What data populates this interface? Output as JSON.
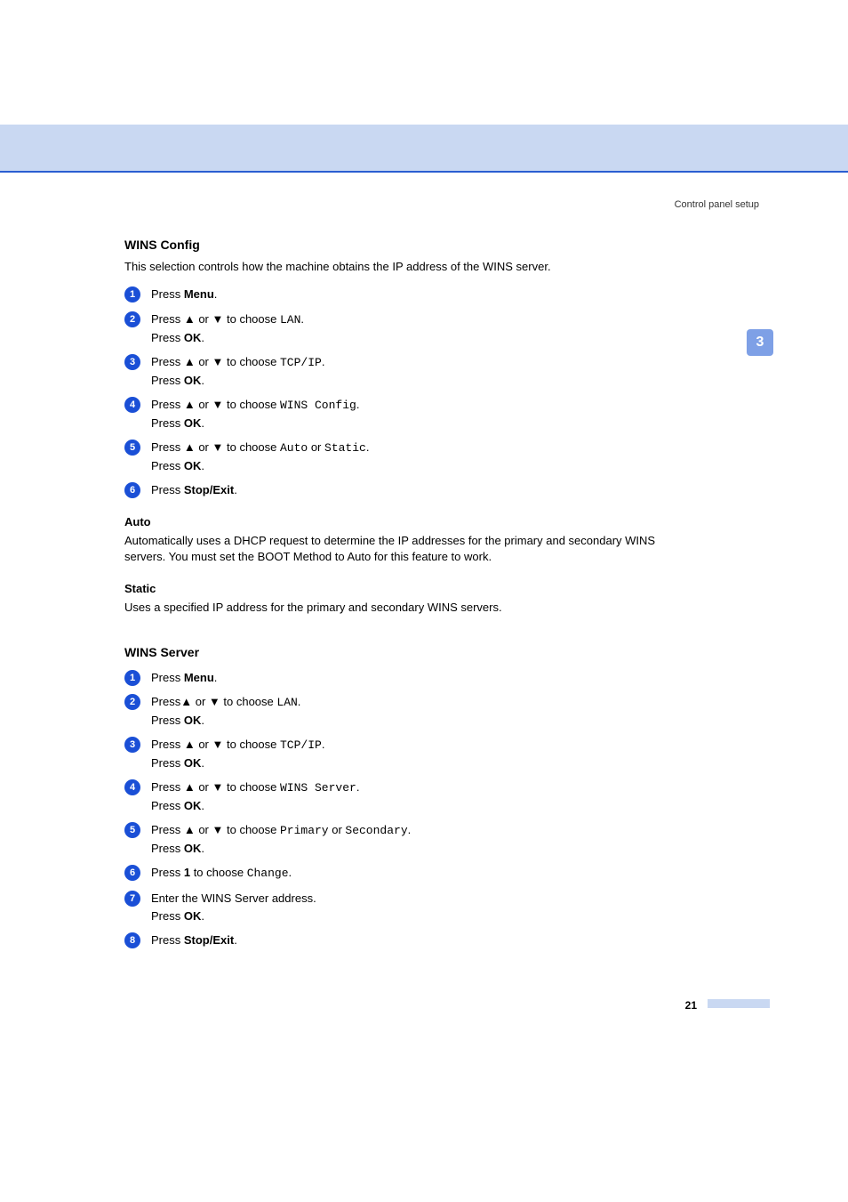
{
  "header": {
    "right_label": "Control panel setup"
  },
  "chapter_tab": "3",
  "section_a": {
    "title": "WINS Config",
    "intro": "This selection controls how the machine obtains the IP address of the WINS server.",
    "steps": [
      {
        "n": "1",
        "pre1": "Press ",
        "b1": "Menu",
        "post1": "."
      },
      {
        "n": "2",
        "pre1": "Press ",
        "arrows": true,
        "mid1": " to choose ",
        "m1": "LAN",
        "post1": ".",
        "pre2": "Press ",
        "b2": "OK",
        "post2": "."
      },
      {
        "n": "3",
        "pre1": "Press ",
        "arrows": true,
        "mid1": " to choose ",
        "m1": "TCP/IP",
        "post1": ".",
        "pre2": "Press ",
        "b2": "OK",
        "post2": "."
      },
      {
        "n": "4",
        "pre1": "Press ",
        "arrows": true,
        "mid1": " to choose ",
        "m1": "WINS Config",
        "post1": ".",
        "pre2": "Press ",
        "b2": "OK",
        "post2": "."
      },
      {
        "n": "5",
        "pre1": "Press ",
        "arrows": true,
        "mid1": " to choose ",
        "m1": "Auto",
        "mid2": " or ",
        "m2": "Static",
        "post1": ".",
        "pre2": "Press ",
        "b2": "OK",
        "post2": "."
      },
      {
        "n": "6",
        "pre1": "Press ",
        "b1": "Stop/Exit",
        "post1": "."
      }
    ],
    "sub_a": {
      "title": "Auto",
      "body": "Automatically uses a DHCP request to determine the IP addresses for the primary and secondary WINS servers. You must set the BOOT Method to Auto for this feature to work."
    },
    "sub_b": {
      "title": "Static",
      "body": "Uses a specified IP address for the primary and secondary WINS servers."
    }
  },
  "section_b": {
    "title": "WINS Server",
    "steps": [
      {
        "n": "1",
        "pre1": "Press ",
        "b1": "Menu",
        "post1": "."
      },
      {
        "n": "2",
        "pre1": "Press",
        "arrows": true,
        "mid1": " to choose ",
        "m1": "LAN",
        "post1": ".",
        "pre2": "Press ",
        "b2": "OK",
        "post2": "."
      },
      {
        "n": "3",
        "pre1": "Press ",
        "arrows": true,
        "mid1": " to choose ",
        "m1": "TCP/IP",
        "post1": ".",
        "pre2": "Press ",
        "b2": "OK",
        "post2": "."
      },
      {
        "n": "4",
        "pre1": "Press ",
        "arrows": true,
        "mid1": " to choose ",
        "m1": "WINS Server",
        "post1": ".",
        "pre2": "Press ",
        "b2": "OK",
        "post2": "."
      },
      {
        "n": "5",
        "pre1": "Press ",
        "arrows": true,
        "mid1": " to choose ",
        "m1": "Primary",
        "mid2": " or ",
        "m2": "Secondary",
        "post1": ".",
        "pre2": "Press ",
        "b2": "OK",
        "post2": "."
      },
      {
        "n": "6",
        "pre1": "Press ",
        "b1": "1",
        "mid1": " to choose ",
        "m1": "Change",
        "post1": "."
      },
      {
        "n": "7",
        "pre1": "Enter the WINS Server address.",
        "pre2": "Press ",
        "b2": "OK",
        "post2": "."
      },
      {
        "n": "8",
        "pre1": "Press ",
        "b1": "Stop/Exit",
        "post1": "."
      }
    ]
  },
  "arrows": {
    "up": "▲",
    "down": "▼",
    "sep": " or "
  },
  "page_number": "21"
}
